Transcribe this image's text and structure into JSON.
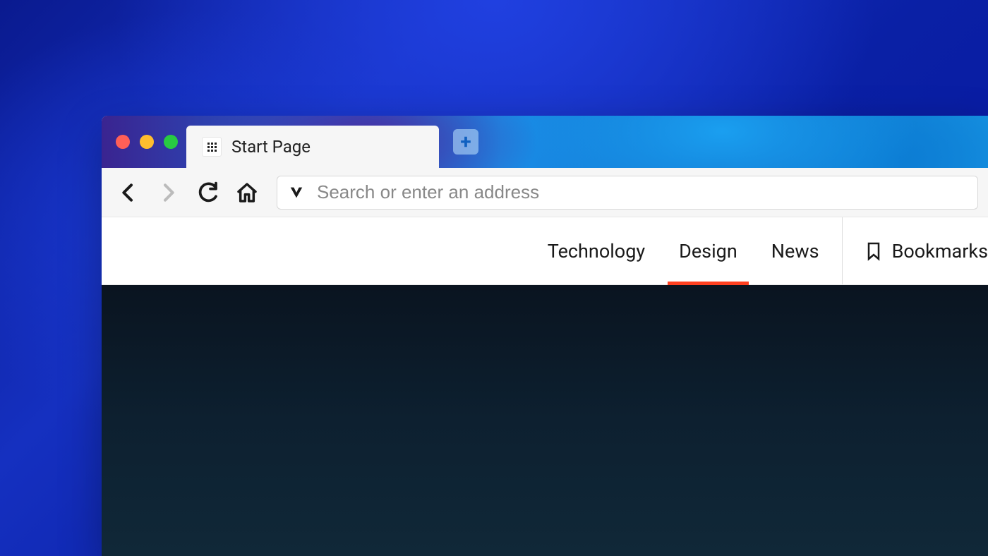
{
  "tab": {
    "title": "Start Page"
  },
  "address": {
    "placeholder": "Search or enter an address"
  },
  "nav": {
    "items": [
      {
        "label": "Technology",
        "active": false
      },
      {
        "label": "Design",
        "active": true
      },
      {
        "label": "News",
        "active": false
      }
    ],
    "bookmarks_label": "Bookmarks"
  }
}
